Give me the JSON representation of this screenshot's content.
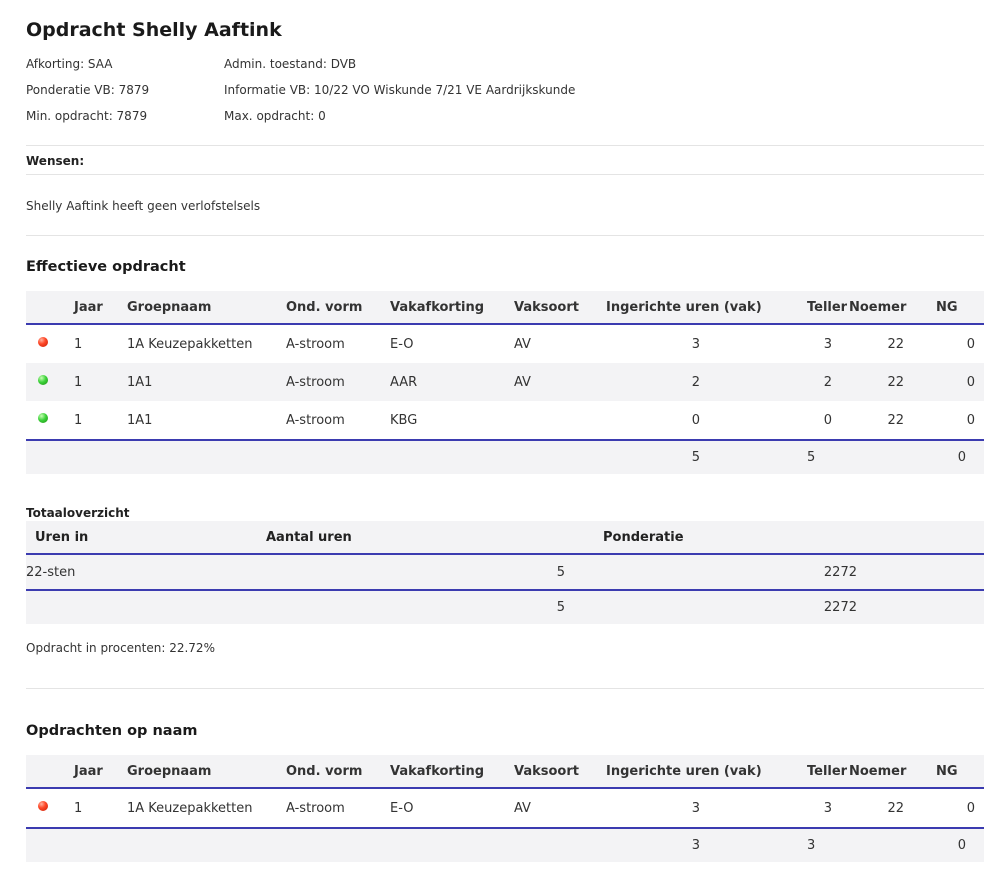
{
  "header": {
    "title": "Opdracht Shelly Aaftink",
    "afkorting": "Afkorting: SAA",
    "admin": "Admin. toestand: DVB",
    "ponderatie": "Ponderatie VB: 7879",
    "informatie": "Informatie VB: 10/22 VO Wiskunde 7/21 VE Aardrijkskunde",
    "min": "Min. opdracht: 7879",
    "max": "Max. opdracht: 0"
  },
  "wensen": {
    "label": "Wensen:",
    "verlof": "Shelly Aaftink heeft geen verlofstelsels"
  },
  "effectief": {
    "title": "Effectieve opdracht",
    "columns": [
      "",
      "Jaar",
      "Groepnaam",
      "Ond. vorm",
      "Vakafkorting",
      "Vaksoort",
      "Ingerichte uren (vak)",
      "Teller",
      "Noemer",
      "NG"
    ],
    "rows": [
      {
        "status": "red",
        "jaar": "1",
        "groep": "1A Keuzepakketten",
        "vorm": "A-stroom",
        "vak": "E-O",
        "soort": "AV",
        "uren": "3",
        "teller": "3",
        "noemer": "22",
        "ng": "0"
      },
      {
        "status": "green",
        "jaar": "1",
        "groep": "1A1",
        "vorm": "A-stroom",
        "vak": "AAR",
        "soort": "AV",
        "uren": "2",
        "teller": "2",
        "noemer": "22",
        "ng": "0"
      },
      {
        "status": "green",
        "jaar": "1",
        "groep": "1A1",
        "vorm": "A-stroom",
        "vak": "KBG",
        "soort": "",
        "uren": "0",
        "teller": "0",
        "noemer": "22",
        "ng": "0"
      }
    ],
    "totals": {
      "uren": "5",
      "teller": "5",
      "ng": "0"
    }
  },
  "totaal": {
    "title": "Totaaloverzicht",
    "columns": [
      "Uren in",
      "Aantal uren",
      "Ponderatie"
    ],
    "row": {
      "uren_in": "22-sten",
      "aantal": "5",
      "ponderatie": "2272"
    },
    "totals": {
      "aantal": "5",
      "ponderatie": "2272"
    },
    "percent": "Opdracht in procenten: 22.72%"
  },
  "opnaam": {
    "title": "Opdrachten op naam",
    "columns": [
      "",
      "Jaar",
      "Groepnaam",
      "Ond. vorm",
      "Vakafkorting",
      "Vaksoort",
      "Ingerichte uren (vak)",
      "Teller",
      "Noemer",
      "NG"
    ],
    "rows": [
      {
        "status": "red",
        "jaar": "1",
        "groep": "1A Keuzepakketten",
        "vorm": "A-stroom",
        "vak": "E-O",
        "soort": "AV",
        "uren": "3",
        "teller": "3",
        "noemer": "22",
        "ng": "0"
      }
    ],
    "totals": {
      "uren": "3",
      "teller": "3",
      "ng": "0"
    }
  },
  "colors": {
    "accent": "#3b3bb0",
    "row_alt": "#f3f3f5",
    "status_red": "#ff4a2a",
    "status_green": "#3cd23a"
  }
}
